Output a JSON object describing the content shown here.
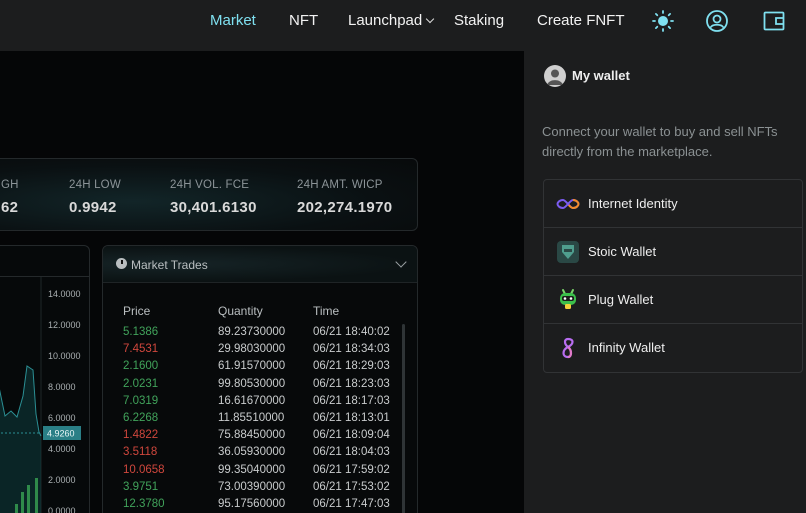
{
  "nav": {
    "items": [
      {
        "label": "Market",
        "active": true
      },
      {
        "label": "NFT"
      },
      {
        "label": "Launchpad",
        "has_dropdown": true
      },
      {
        "label": "Staking"
      },
      {
        "label": "Create FNFT"
      }
    ],
    "icons": [
      "theme-sun-icon",
      "account-icon",
      "wallet-icon"
    ],
    "accent_color": "#7fe0f0"
  },
  "stats": [
    {
      "label": "GH",
      "value": "62"
    },
    {
      "label": "24H LOW",
      "value": "0.9942"
    },
    {
      "label": "24H VOL. FCE",
      "value": "30,401.6130"
    },
    {
      "label": "24H AMT. WICP",
      "value": "202,274.1970"
    }
  ],
  "chart": {
    "y_ticks": [
      "14.0000",
      "12.0000",
      "10.0000",
      "8.0000",
      "6.0000",
      "4.0000",
      "2.0000",
      "0.0000"
    ],
    "current_price": "4.9260",
    "current_price_color": "#2a7f86"
  },
  "trades": {
    "title": "Market Trades",
    "columns": [
      "Price",
      "Quantity",
      "Time"
    ],
    "rows": [
      {
        "price": "5.1386",
        "qty": "89.23730000",
        "time": "06/21 18:40:02",
        "side": "buy"
      },
      {
        "price": "7.4531",
        "qty": "29.98030000",
        "time": "06/21 18:34:03",
        "side": "sell"
      },
      {
        "price": "2.1600",
        "qty": "61.91570000",
        "time": "06/21 18:29:03",
        "side": "buy"
      },
      {
        "price": "2.0231",
        "qty": "99.80530000",
        "time": "06/21 18:23:03",
        "side": "buy"
      },
      {
        "price": "7.0319",
        "qty": "16.61670000",
        "time": "06/21 18:17:03",
        "side": "buy"
      },
      {
        "price": "6.2268",
        "qty": "11.85510000",
        "time": "06/21 18:13:01",
        "side": "buy"
      },
      {
        "price": "1.4822",
        "qty": "75.88450000",
        "time": "06/21 18:09:04",
        "side": "sell"
      },
      {
        "price": "3.5118",
        "qty": "36.05930000",
        "time": "06/21 18:04:03",
        "side": "sell"
      },
      {
        "price": "10.0658",
        "qty": "99.35040000",
        "time": "06/21 17:59:02",
        "side": "sell"
      },
      {
        "price": "3.9751",
        "qty": "73.00390000",
        "time": "06/21 17:53:02",
        "side": "buy"
      },
      {
        "price": "12.3780",
        "qty": "95.17560000",
        "time": "06/21 17:47:03",
        "side": "buy"
      }
    ],
    "buy_color": "#41a35b",
    "sell_color": "#d0473d"
  },
  "wallet": {
    "title": "My wallet",
    "description": "Connect your wallet to buy and sell NFTs directly from the marketplace.",
    "options": [
      {
        "label": "Internet Identity",
        "icon": "internet-identity-icon"
      },
      {
        "label": "Stoic Wallet",
        "icon": "stoic-wallet-icon"
      },
      {
        "label": "Plug Wallet",
        "icon": "plug-wallet-icon"
      },
      {
        "label": "Infinity Wallet",
        "icon": "infinity-wallet-icon"
      }
    ]
  }
}
